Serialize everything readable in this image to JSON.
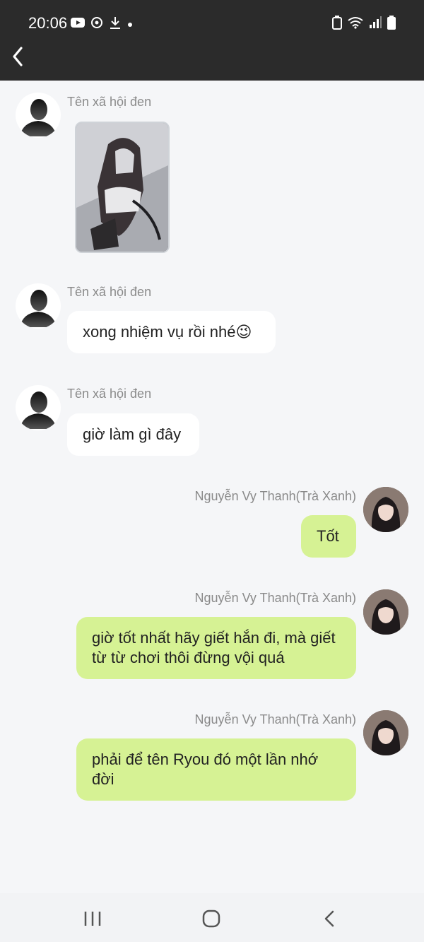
{
  "status": {
    "time": "20:06",
    "left_icons": [
      "youtube-icon",
      "sync-icon",
      "download-icon",
      "dot-icon"
    ],
    "right_icons": [
      "battery-saver-icon",
      "wifi-icon",
      "signal-icon",
      "battery-icon"
    ]
  },
  "header": {
    "back_icon": "back-arrow-icon"
  },
  "messages": [
    {
      "side": "left",
      "sender": "Tên xã hội đen",
      "type": "image",
      "image": "character-artwork"
    },
    {
      "side": "left",
      "sender": "Tên xã hội đen",
      "type": "text",
      "text": "xong nhiệm vụ rồi nhé😉"
    },
    {
      "side": "left",
      "sender": "Tên xã hội đen",
      "type": "text",
      "text": "giờ làm gì đây"
    },
    {
      "side": "right",
      "sender": "Nguyễn Vy Thanh(Trà Xanh)",
      "type": "text",
      "text": "Tốt"
    },
    {
      "side": "right",
      "sender": "Nguyễn Vy Thanh(Trà Xanh)",
      "type": "text",
      "text": "giờ tốt nhất hãy giết hắn đi, mà giết từ từ chơi thôi đừng vội quá"
    },
    {
      "side": "right",
      "sender": "Nguyễn Vy Thanh(Trà Xanh)",
      "type": "text",
      "text": "phải để tên Ryou đó một lần nhớ đời"
    }
  ],
  "colors": {
    "outgoing_bubble": "#d6f294",
    "incoming_bubble": "#ffffff",
    "topbar": "#2b2b2b"
  },
  "navbar": {
    "icons": [
      "recent-apps-icon",
      "home-icon",
      "back-icon"
    ]
  }
}
